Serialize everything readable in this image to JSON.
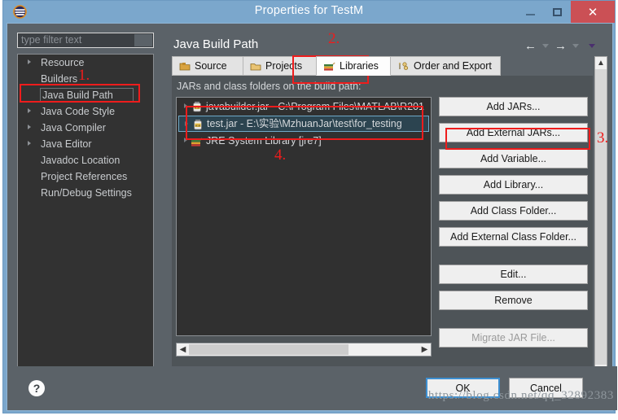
{
  "window": {
    "title": "Properties for TestM",
    "icon": "eclipse-icon",
    "controls": {
      "minimize": "minimize-icon",
      "maximize": "maximize-icon",
      "close": "✕"
    }
  },
  "sidebar": {
    "filter": {
      "placeholder": "type filter text",
      "value": ""
    },
    "items": [
      {
        "label": "Resource",
        "expandable": true,
        "selected": false
      },
      {
        "label": "Builders",
        "expandable": false,
        "selected": false
      },
      {
        "label": "Java Build Path",
        "expandable": false,
        "selected": true
      },
      {
        "label": "Java Code Style",
        "expandable": true,
        "selected": false
      },
      {
        "label": "Java Compiler",
        "expandable": true,
        "selected": false
      },
      {
        "label": "Java Editor",
        "expandable": true,
        "selected": false
      },
      {
        "label": "Javadoc Location",
        "expandable": false,
        "selected": false
      },
      {
        "label": "Project References",
        "expandable": false,
        "selected": false
      },
      {
        "label": "Run/Debug Settings",
        "expandable": false,
        "selected": false
      }
    ]
  },
  "page": {
    "title": "Java Build Path",
    "nav": {
      "back": "←",
      "back_caret": "▼",
      "forward": "→",
      "forward_caret": "▼",
      "menu_caret": "▼"
    }
  },
  "tabs": [
    {
      "label": "Source",
      "icon": "source-folder-icon",
      "active": false
    },
    {
      "label": "Projects",
      "icon": "projects-folder-icon",
      "active": false
    },
    {
      "label": "Libraries",
      "icon": "libraries-books-icon",
      "active": true
    },
    {
      "label": "Order and Export",
      "icon": "order-export-icon",
      "active": false
    }
  ],
  "libraries": {
    "description": "JARs and class folders on the build path:",
    "entries": [
      {
        "label": "javabuilder.jar - C:\\Program Files\\MATLAB\\R201",
        "icon": "jar-icon",
        "expandable": true,
        "selected": false
      },
      {
        "label": "test.jar - E:\\实验\\MzhuanJar\\test\\for_testing",
        "icon": "jar-icon",
        "expandable": true,
        "selected": true
      },
      {
        "label": "JRE System Library [jre7]",
        "icon": "library-books-icon",
        "expandable": true,
        "selected": false
      }
    ],
    "buttons": [
      {
        "label": "Add JARs...",
        "enabled": true,
        "highlighted": false
      },
      {
        "label": "Add External JARs...",
        "enabled": true,
        "highlighted": true
      },
      {
        "label": "Add Variable...",
        "enabled": true,
        "highlighted": false
      },
      {
        "label": "Add Library...",
        "enabled": true,
        "highlighted": false
      },
      {
        "label": "Add Class Folder...",
        "enabled": true,
        "highlighted": false
      },
      {
        "label": "Add External Class Folder...",
        "enabled": true,
        "highlighted": false
      },
      {
        "label": "Edit...",
        "enabled": true,
        "highlighted": false
      },
      {
        "label": "Remove",
        "enabled": true,
        "highlighted": false
      },
      {
        "label": "Migrate JAR File...",
        "enabled": false,
        "highlighted": false
      }
    ]
  },
  "footer": {
    "help": "?",
    "ok": "OK",
    "cancel": "Cancel",
    "watermark": "https://blog.csdn.net/qq_32892383"
  },
  "annotations": [
    {
      "number": "1.",
      "target": "Java Build Path sidebar item"
    },
    {
      "number": "2.",
      "target": "Libraries tab"
    },
    {
      "number": "3.",
      "target": "Add External JARs... button"
    },
    {
      "number": "4.",
      "target": "JAR entries list"
    }
  ],
  "colors": {
    "accent_blue": "#7ba7cc",
    "close_red": "#cb5055",
    "annotation_red": "#ee1c1c",
    "panel_gray": "#5b6268",
    "tree_dark": "#323232",
    "selection": "#2c4450"
  }
}
